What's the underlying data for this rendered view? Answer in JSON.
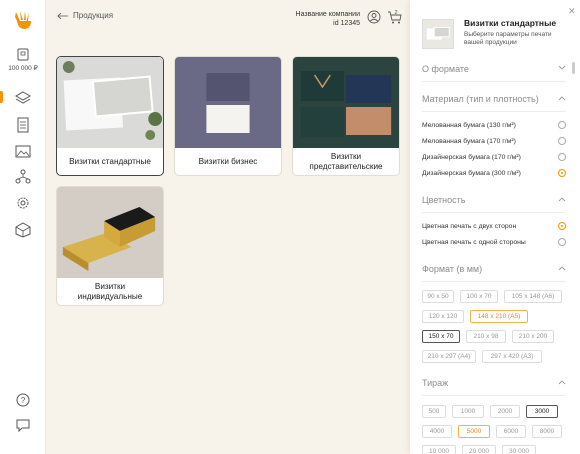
{
  "header": {
    "back_label": "Продукция",
    "company_name": "Название компании",
    "company_id": "id 12345",
    "cart_count": "2"
  },
  "sidebar": {
    "balance": "100 000 ₽",
    "accent": "#f29300"
  },
  "products": [
    {
      "label": "Визитки стандартные"
    },
    {
      "label": "Визитки бизнес"
    },
    {
      "label": "Визитки представительские"
    },
    {
      "label": "Визитки индивидуальные"
    }
  ],
  "panel": {
    "title": "Визитки стандартные",
    "subtitle": "Выберите параметры печати вашей продукции",
    "sections": {
      "format_about": "О формате",
      "material": "Материал (тип и плотность)",
      "color": "Цветность",
      "size": "Формат (в мм)",
      "run": "Тираж"
    },
    "materials": [
      {
        "label": "Мелованная бумага (130 г/м²)",
        "selected": false
      },
      {
        "label": "Мелованная бумага (170 г/м²)",
        "selected": false
      },
      {
        "label": "Дизайнерская бумага (170 г/м²)",
        "selected": false
      },
      {
        "label": "Дизайнерская бумага (300 г/м²)",
        "selected": true
      }
    ],
    "colors": [
      {
        "label": "Цветная печать с двух сторон",
        "selected": true
      },
      {
        "label": "Цветная печать с одной стороны",
        "selected": false
      }
    ],
    "sizes": [
      "90 x 50",
      "100 x 70",
      "105 x 148 (A6)",
      "120 x 120",
      "148 x 210 (A5)",
      "150 x 70",
      "210 x 98",
      "210 x 200",
      "210 x 297 (A4)",
      "297 x 420 (A3)"
    ],
    "runs": [
      "500",
      "1000",
      "2000",
      "3000",
      "4000",
      "5000",
      "6000",
      "8000",
      "10 000",
      "20 000",
      "30 000"
    ]
  }
}
